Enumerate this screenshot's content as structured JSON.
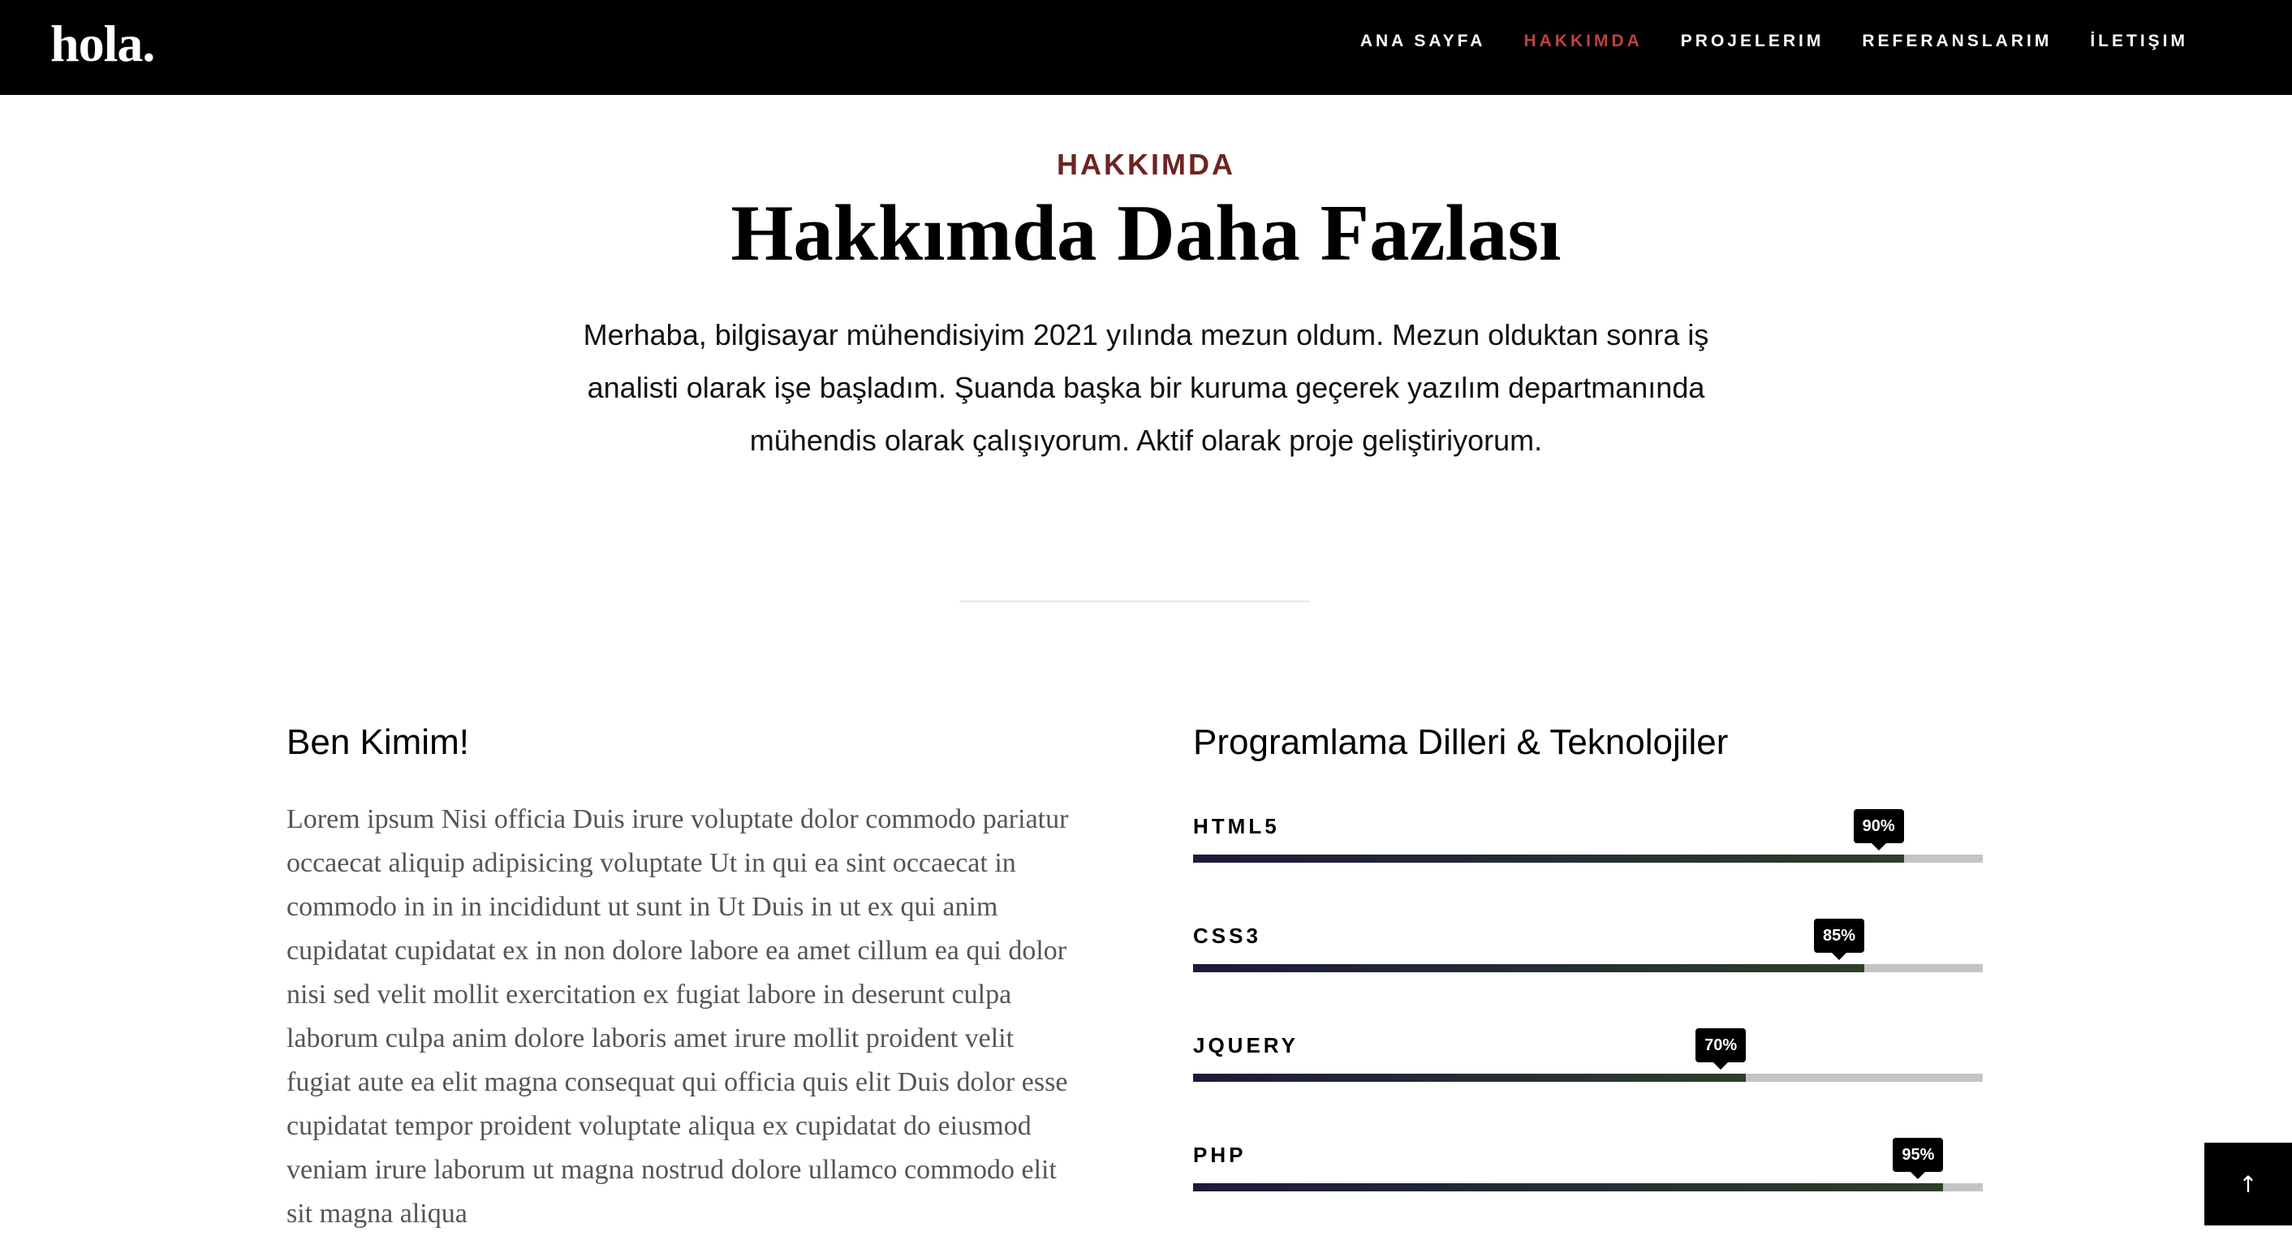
{
  "header": {
    "logo": "hola.",
    "nav": [
      {
        "label": "ANA SAYFA",
        "active": false
      },
      {
        "label": "HAKKIMDA",
        "active": true
      },
      {
        "label": "PROJELERIM",
        "active": false
      },
      {
        "label": "REFERANSLARIM",
        "active": false
      },
      {
        "label": "İLETIŞIM",
        "active": false
      }
    ]
  },
  "about": {
    "eyebrow": "HAKKIMDA",
    "title": "Hakkımda Daha Fazlası",
    "intro": "Merhaba, bilgisayar mühendisiyim 2021 yılında mezun oldum. Mezun olduktan sonra iş analisti olarak işe başladım. Şuanda başka bir kuruma geçerek yazılım departmanında mühendis olarak çalışıyorum. Aktif olarak proje geliştiriyorum."
  },
  "who": {
    "title": "Ben Kimim!",
    "text": "Lorem ipsum Nisi officia Duis irure voluptate dolor commodo pariatur occaecat aliquip adipisicing voluptate Ut in qui ea sint occaecat in commodo in in in incididunt ut sunt in Ut Duis in ut ex qui anim cupidatat cupidatat ex in non dolore labore ea amet cillum ea qui dolor nisi sed velit mollit exercitation ex fugiat labore in deserunt culpa laborum culpa anim dolore laboris amet irure mollit proident velit fugiat aute ea elit magna consequat qui officia quis elit Duis dolor esse cupidatat tempor proident voluptate aliqua ex cupidatat do eiusmod veniam irure laborum ut magna nostrud dolore ullamco commodo elit sit magna aliqua"
  },
  "skills": {
    "title": "Programlama Dilleri & Teknolojiler",
    "items": [
      {
        "name": "HTML5",
        "percent": 90,
        "label": "90%"
      },
      {
        "name": "CSS3",
        "percent": 85,
        "label": "85%"
      },
      {
        "name": "JQUERY",
        "percent": 70,
        "label": "70%"
      },
      {
        "name": "PHP",
        "percent": 95,
        "label": "95%"
      }
    ]
  },
  "back_to_top": {
    "icon": "arrow-up-icon",
    "glyph": "↑"
  },
  "colors": {
    "accent": "#c0413e",
    "eyebrow": "#6d2422",
    "header_bg": "#000000",
    "bar_track": "#c4c4c4"
  }
}
